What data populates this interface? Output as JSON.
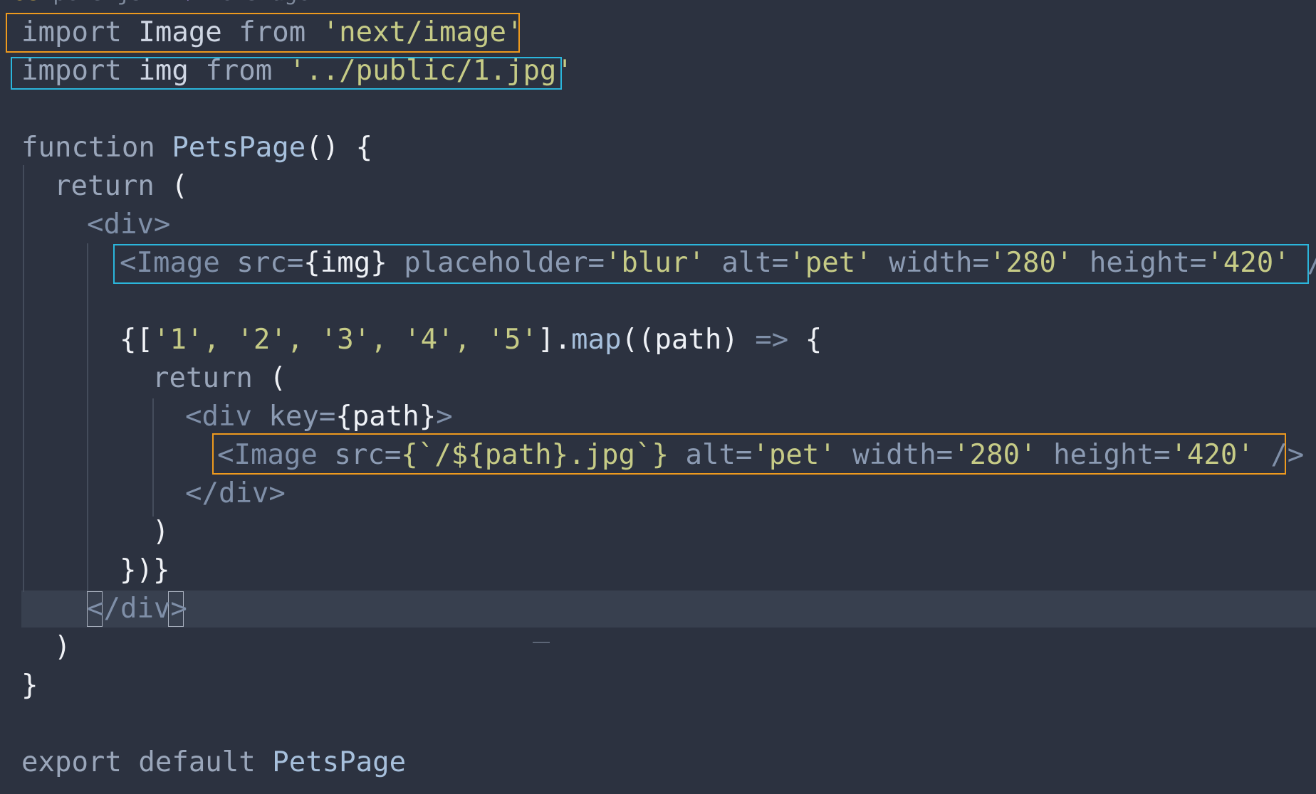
{
  "breadcrumb": {
    "file": "pets.js",
    "separator": ">",
    "symbol": "PetsPage"
  },
  "lines": {
    "l1": {
      "kw": "import",
      "name": "Image",
      "from": "from",
      "str": "'next/image'"
    },
    "l2": {
      "kw": "import",
      "name": "img",
      "from": "from",
      "str": "'../public/1.jpg'"
    },
    "l4": {
      "kw": "function",
      "name": "PetsPage",
      "rest": "() {"
    },
    "l5": {
      "kw": "return",
      "rest": "("
    },
    "l6": {
      "open": "<div>"
    },
    "l7": {
      "tag": "<Image",
      "a1": "src=",
      "v1": "{img}",
      "a2": "placeholder=",
      "v2": "'blur'",
      "a3": "alt=",
      "v3": "'pet'",
      "a4": "width=",
      "v4": "'280'",
      "a5": "height=",
      "v5": "'420'",
      "close": "/>"
    },
    "l9": {
      "brace": "{[",
      "items": "'1', '2', '3', '4', '5'",
      "end": "].",
      "fn": "map",
      "args": "((path)",
      "arrow": "=>",
      "tail": "{"
    },
    "l10": {
      "kw": "return",
      "rest": "("
    },
    "l11": {
      "tag": "<div",
      "attr": "key=",
      "val": "{path}",
      "close": ">"
    },
    "l12": {
      "tag": "<Image",
      "a1": "src=",
      "v1": "{`/${path}.jpg`}",
      "a3": "alt=",
      "v3": "'pet'",
      "a4": "width=",
      "v4": "'280'",
      "a5": "height=",
      "v5": "'420'",
      "close": "/>"
    },
    "l13": {
      "close": "</div>"
    },
    "l14": {
      "paren": ")"
    },
    "l15": {
      "close": "})}"
    },
    "l16": {
      "open": "<",
      "text": "/div",
      "end": ">"
    },
    "l17": {
      "paren": ")"
    },
    "l18": {
      "brace": "}"
    },
    "l20": {
      "kw": "export",
      "kw2": "default",
      "name": "PetsPage"
    }
  },
  "colors": {
    "background": "#2c3240",
    "highlight_orange": "#ee9a1e",
    "highlight_cyan": "#2bb6dc",
    "string": "#c6cb86",
    "keyword": "#9aa6ba"
  }
}
